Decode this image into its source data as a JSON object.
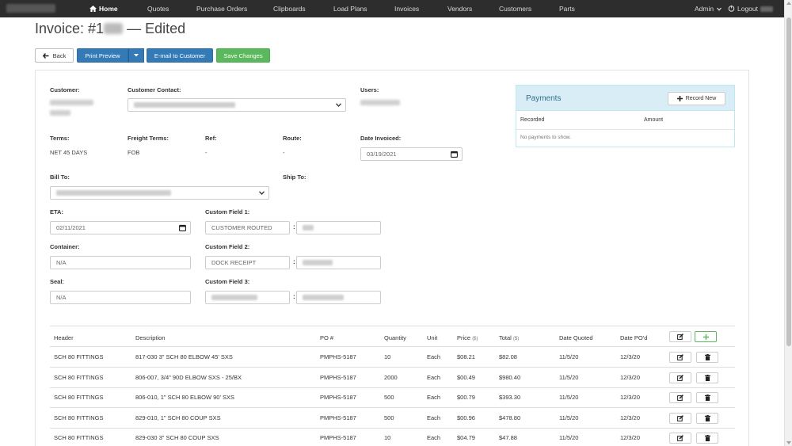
{
  "nav": {
    "items": [
      {
        "label": "Home",
        "active": true
      },
      {
        "label": "Quotes"
      },
      {
        "label": "Purchase Orders"
      },
      {
        "label": "Clipboards"
      },
      {
        "label": "Load Plans"
      },
      {
        "label": "Invoices"
      },
      {
        "label": "Vendors"
      },
      {
        "label": "Customers"
      },
      {
        "label": "Parts"
      }
    ],
    "admin_label": "Admin",
    "logout_label": "Logout"
  },
  "page": {
    "title_prefix": "Invoice: #1",
    "title_suffix": "— Edited"
  },
  "toolbar": {
    "back_label": "Back",
    "print_label": "Print Preview",
    "email_label": "E-mail to Customer",
    "save_label": "Save Changes"
  },
  "form": {
    "customer_label": "Customer:",
    "customer_contact_label": "Customer Contact:",
    "users_label": "Users:",
    "terms_label": "Terms:",
    "terms_value": "NET 45 DAYS",
    "freight_terms_label": "Freight Terms:",
    "freight_terms_value": "FOB",
    "ref_label": "Ref:",
    "ref_value": "-",
    "route_label": "Route:",
    "route_value": "-",
    "date_invoiced_label": "Date Invoiced:",
    "date_invoiced_value": "03/19/2021",
    "bill_to_label": "Bill To:",
    "ship_to_label": "Ship To:",
    "eta_label": "ETA:",
    "eta_value": "02/11/2021",
    "container_label": "Container:",
    "container_value": "N/A",
    "seal_label": "Seal:",
    "seal_value": "N/A",
    "custom1_label": "Custom Field 1:",
    "custom1_key": "CUSTOMER ROUTED",
    "custom2_label": "Custom Field 2:",
    "custom2_key": "DOCK RECEIPT",
    "custom3_label": "Custom Field 3:",
    "colon": ":"
  },
  "payments": {
    "title": "Payments",
    "record_label": "Record New",
    "col_recorded": "Recorded",
    "col_amount": "Amount",
    "empty_text": "No payments to show."
  },
  "table": {
    "headers": {
      "header": "Header",
      "description": "Description",
      "po": "PO #",
      "quantity": "Quantity",
      "unit": "Unit",
      "price": "Price",
      "price_unit": "($)",
      "total": "Total",
      "total_unit": "($)",
      "date_quoted": "Date Quoted",
      "date_pod": "Date PO'd"
    },
    "rows": [
      {
        "header": "SCH 80 FITTINGS",
        "description": "817-030 3\" SCH 80 ELBOW 45' SXS",
        "po": "PMPHS-5187",
        "quantity": "10",
        "unit": "Each",
        "price": "$08.21",
        "total": "$82.08",
        "date_quoted": "11/5/20",
        "date_pod": "12/3/20"
      },
      {
        "header": "SCH 80 FITTINGS",
        "description": "806-007, 3/4\" 90D ELBOW SXS - 25/BX",
        "po": "PMPHS-5187",
        "quantity": "2000",
        "unit": "Each",
        "price": "$00.49",
        "total": "$980.40",
        "date_quoted": "11/5/20",
        "date_pod": "12/3/20"
      },
      {
        "header": "SCH 80 FITTINGS",
        "description": "806-010, 1\" SCH 80 ELBOW 90' SXS",
        "po": "PMPHS-5187",
        "quantity": "500",
        "unit": "Each",
        "price": "$00.79",
        "total": "$393.30",
        "date_quoted": "11/5/20",
        "date_pod": "12/3/20"
      },
      {
        "header": "SCH 80 FITTINGS",
        "description": "829-010, 1\" SCH 80 COUP SXS",
        "po": "PMPHS-5187",
        "quantity": "500",
        "unit": "Each",
        "price": "$00.96",
        "total": "$478.80",
        "date_quoted": "11/5/20",
        "date_pod": "12/3/20"
      },
      {
        "header": "SCH 80 FITTINGS",
        "description": "829-030 3\" SCH 80 COUP SXS",
        "po": "PMPHS-5187",
        "quantity": "10",
        "unit": "Each",
        "price": "$04.79",
        "total": "$47.88",
        "date_quoted": "11/5/20",
        "date_pod": "12/3/20"
      }
    ]
  },
  "icons": {
    "home": "home-icon",
    "back": "arrow-left-icon",
    "caret": "caret-down-icon",
    "calendar": "calendar-icon",
    "select": "chevron-down-icon",
    "plus": "plus-icon",
    "edit": "edit-icon",
    "delete": "trash-icon"
  },
  "colors": {
    "navbar": "#2d2d2d",
    "primary": "#337ab7",
    "success": "#5cb85c",
    "panel_header": "#d9edf7",
    "panel_title": "#31708f"
  }
}
